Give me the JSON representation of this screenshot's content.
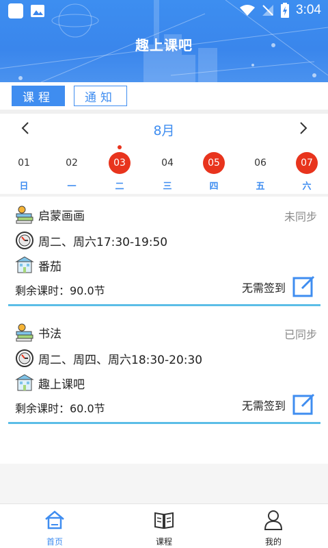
{
  "status_bar": {
    "time": "3:04"
  },
  "header": {
    "title": "趣上课吧"
  },
  "tabs": [
    {
      "label": "课程",
      "active": true
    },
    {
      "label": "通知",
      "active": false
    }
  ],
  "calendar": {
    "month": "8月",
    "days": [
      {
        "num": "01",
        "weekday": "日",
        "selected": false,
        "dot": false
      },
      {
        "num": "02",
        "weekday": "一",
        "selected": false,
        "dot": false
      },
      {
        "num": "03",
        "weekday": "二",
        "selected": true,
        "dot": true
      },
      {
        "num": "04",
        "weekday": "三",
        "selected": false,
        "dot": false
      },
      {
        "num": "05",
        "weekday": "四",
        "selected": true,
        "dot": false
      },
      {
        "num": "06",
        "weekday": "五",
        "selected": false,
        "dot": false
      },
      {
        "num": "07",
        "weekday": "六",
        "selected": true,
        "dot": false
      }
    ]
  },
  "courses": [
    {
      "name": "启蒙画画",
      "sync_status": "未同步",
      "schedule": "周二、周六17:30-19:50",
      "location": "番茄",
      "remaining": "剩余课时：90.0节",
      "sign_status": "无需签到"
    },
    {
      "name": "书法",
      "sync_status": "已同步",
      "schedule": "周二、周四、周六18:30-20:30",
      "location": "趣上课吧",
      "remaining": "剩余课时：60.0节",
      "sign_status": "无需签到"
    }
  ],
  "bottom_nav": [
    {
      "label": "首页",
      "icon": "home-icon",
      "active": true
    },
    {
      "label": "课程",
      "icon": "book-icon",
      "active": false
    },
    {
      "label": "我的",
      "icon": "person-icon",
      "active": false
    }
  ],
  "colors": {
    "primary": "#3f8df0",
    "accent_red": "#e8341d",
    "divider_blue": "#5bbde7"
  }
}
